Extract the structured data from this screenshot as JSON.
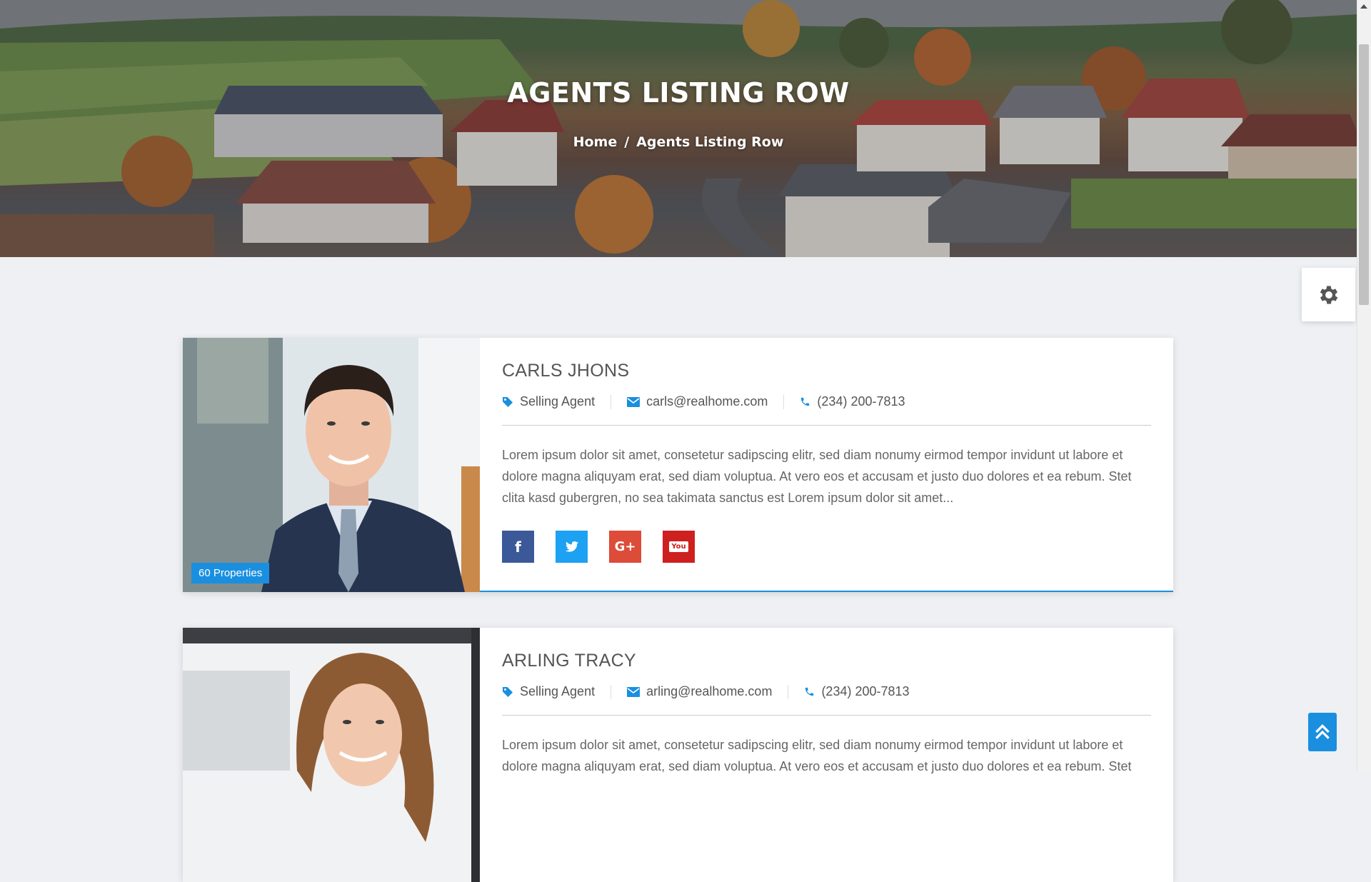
{
  "hero": {
    "title": "AGENTS LISTING ROW",
    "breadcrumb": {
      "home": "Home",
      "separator": "/",
      "current": "Agents Listing Row"
    }
  },
  "settings": {
    "icon": "gear-icon"
  },
  "agents": [
    {
      "name": "CARLS JHONS",
      "role": "Selling Agent",
      "email": "carls@realhome.com",
      "phone": "(234) 200-7813",
      "properties_badge": "60 Properties",
      "description": "Lorem ipsum dolor sit amet, consetetur sadipscing elitr, sed diam nonumy eirmod tempor invidunt ut labore et dolore magna aliquyam erat, sed diam voluptua. At vero eos et accusam et justo duo dolores et ea rebum. Stet clita kasd gubergren, no sea takimata sanctus est Lorem ipsum dolor sit amet...",
      "social": [
        {
          "name": "facebook",
          "glyph": "f"
        },
        {
          "name": "twitter",
          "glyph": "t"
        },
        {
          "name": "google-plus",
          "glyph": "G+"
        },
        {
          "name": "youtube",
          "glyph": "You"
        }
      ]
    },
    {
      "name": "ARLING TRACY",
      "role": "Selling Agent",
      "email": "arling@realhome.com",
      "phone": "(234) 200-7813",
      "description": "Lorem ipsum dolor sit amet, consetetur sadipscing elitr, sed diam nonumy eirmod tempor invidunt ut labore et dolore magna aliquyam erat, sed diam voluptua. At vero eos et accusam et justo duo dolores et ea rebum. Stet"
    }
  ],
  "colors": {
    "accent": "#1a8fe0",
    "facebook": "#3b5998",
    "twitter": "#1da1f2",
    "google_plus": "#dd4b39",
    "youtube": "#cd201f",
    "page_bg": "#eef0f3"
  }
}
